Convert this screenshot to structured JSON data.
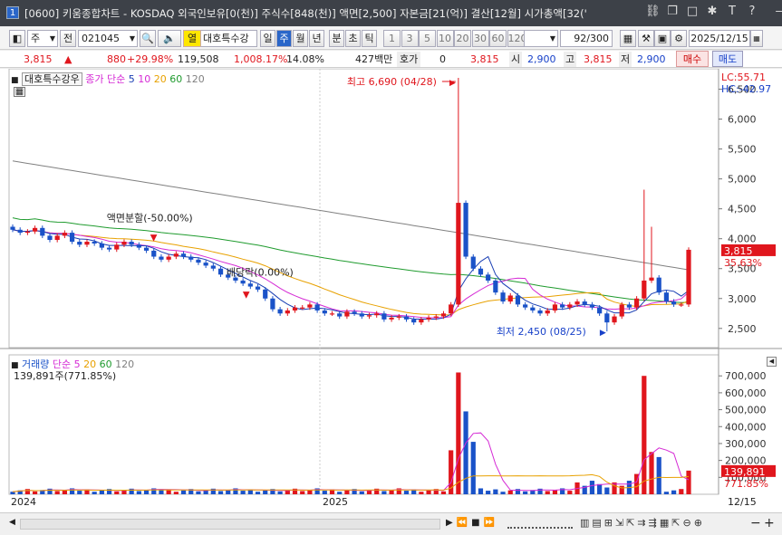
{
  "window": {
    "number": "1",
    "title": "[0600] 키움종합차트 - KOSDAQ 외국인보유[0(천)] 주식수[848(천)] 액면[2,500] 자본금[21(억)] 결산[12월] 시가총액[32('",
    "buttons": [
      "link-icon",
      "restore-icon",
      "maximize-icon",
      "pin-icon",
      "text-icon",
      "help-icon",
      "minimize-icon",
      "close-icon"
    ]
  },
  "toolbar": {
    "period_select": "주",
    "prev_label": "전",
    "code": "021045",
    "flag": "열",
    "stock_name": "대호특수강",
    "periods": [
      "일",
      "주",
      "월",
      "년"
    ],
    "active_period": "주",
    "intraday": [
      "분",
      "초",
      "틱"
    ],
    "intervals": [
      "1",
      "3",
      "5",
      "10",
      "20",
      "30",
      "60",
      "120"
    ],
    "count": "92",
    "count_total": "/300",
    "date": "2025/12/15"
  },
  "quote": {
    "price": "3,815",
    "change": "880",
    "change_pct": "+29.98%",
    "volume": "119,508",
    "volume_pct": "1,008.17%",
    "turnover": "14.08%",
    "amount": "427백만",
    "bid_label": "호가",
    "bid_value": "0",
    "bid_price": "3,815",
    "open_label": "시",
    "open": "2,900",
    "high_label": "고",
    "high": "3,815",
    "low_label": "저",
    "low": "2,900",
    "buy_label": "매수",
    "sell_label": "매도"
  },
  "price_panel": {
    "name_tag": "대호특수강우",
    "ma_label": "종가 단순",
    "ma_periods": [
      "5",
      "10",
      "20",
      "60",
      "120"
    ],
    "lc": "LC:55.71",
    "hc": "HC:-42.97",
    "current_price_tag": "3,815",
    "current_pct_tag": "35.63%",
    "annotations": {
      "high": "최고 6,690 (04/28)",
      "low": "최저 2,450 (08/25)",
      "split": "액면분할(-50.00%)",
      "dividend": "배당락(0.00%)"
    },
    "y_labels": [
      "6,500",
      "6,000",
      "5,500",
      "5,000",
      "4,500",
      "4,000",
      "3,500",
      "3,000",
      "2,500"
    ]
  },
  "volume_panel": {
    "label": "거래량",
    "ma_label": "단순",
    "ma_periods": [
      "5",
      "20",
      "60",
      "120"
    ],
    "info": "139,891주(771.85%)",
    "current_tag": "139,891",
    "current_pct_tag": "771.85%",
    "y_labels": [
      "700,000",
      "600,000",
      "500,000",
      "400,000",
      "300,000",
      "200,000",
      "100,000"
    ]
  },
  "x_axis": {
    "labels": [
      "2024",
      "2025"
    ],
    "last_date": "12/15"
  },
  "colors": {
    "up": "#e0161d",
    "down": "#1a52c8",
    "ma5": "#1a3fb4",
    "ma10": "#d52ad5",
    "ma20": "#e8a100",
    "ma60": "#1f9b2e",
    "ma120": "#808080"
  },
  "chart_data": {
    "type": "candlestick",
    "price_axis_range": [
      2300,
      6690
    ],
    "high_point": {
      "value": 6690,
      "date": "04/28"
    },
    "low_point": {
      "value": 2450,
      "date": "08/25"
    },
    "last": {
      "open": 2900,
      "high": 3815,
      "low": 2900,
      "close": 3815,
      "volume": 139891
    }
  }
}
